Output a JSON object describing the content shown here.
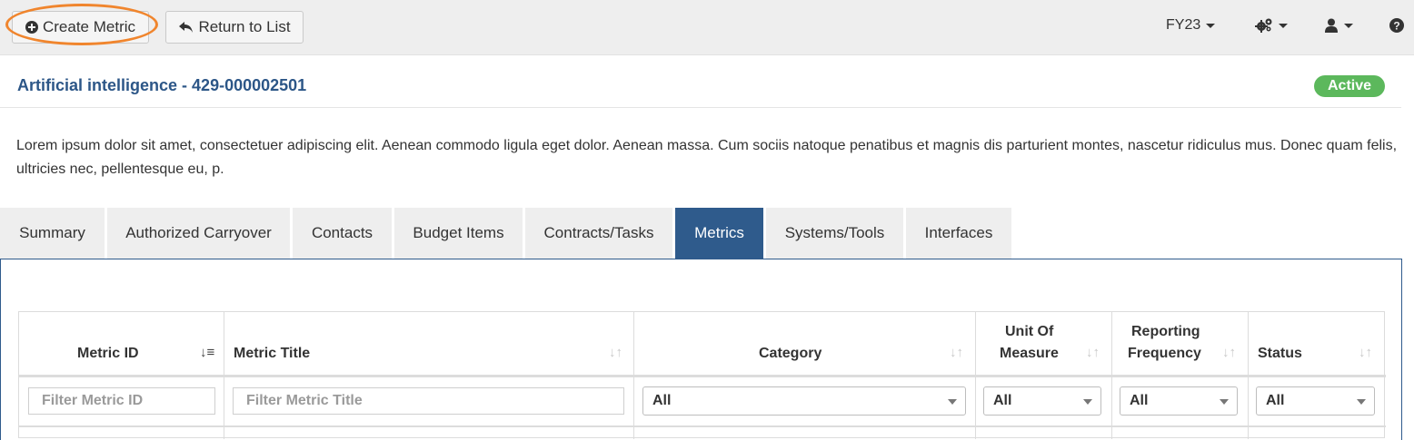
{
  "toolbar": {
    "create_label": "Create Metric",
    "return_label": "Return to List",
    "fiscal_year": "FY23"
  },
  "icons": {
    "create": "plus-circle-icon",
    "return": "reply-arrow-icon",
    "settings": "gears-icon",
    "user": "user-icon",
    "help": "question-circle-icon"
  },
  "project": {
    "title": "Artificial intelligence - 429-000002501",
    "status": "Active",
    "description": "Lorem ipsum dolor sit amet, consectetuer adipiscing elit. Aenean commodo ligula eget dolor. Aenean massa. Cum sociis natoque penatibus et magnis dis parturient montes, nascetur ridiculus mus. Donec quam felis, ultricies nec, pellentesque eu, p."
  },
  "tabs": [
    {
      "label": "Summary"
    },
    {
      "label": "Authorized Carryover"
    },
    {
      "label": "Contacts"
    },
    {
      "label": "Budget Items"
    },
    {
      "label": "Contracts/Tasks"
    },
    {
      "label": "Metrics"
    },
    {
      "label": "Systems/Tools"
    },
    {
      "label": "Interfaces"
    }
  ],
  "active_tab": "Metrics",
  "table": {
    "headers": {
      "metric_id": "Metric ID",
      "metric_title": "Metric Title",
      "category": "Category",
      "unit_line1": "Unit Of",
      "unit_line2": "Measure",
      "freq_line1": "Reporting",
      "freq_line2": "Frequency",
      "status": "Status"
    },
    "filters": {
      "metric_id_placeholder": "Filter Metric ID",
      "metric_title_placeholder": "Filter Metric Title",
      "category": "All",
      "unit": "All",
      "frequency": "All",
      "status": "All"
    }
  },
  "colors": {
    "accent": "#2f5b8c",
    "title": "#2c5687",
    "status_active": "#5cb85c",
    "highlight": "#f0852d"
  }
}
